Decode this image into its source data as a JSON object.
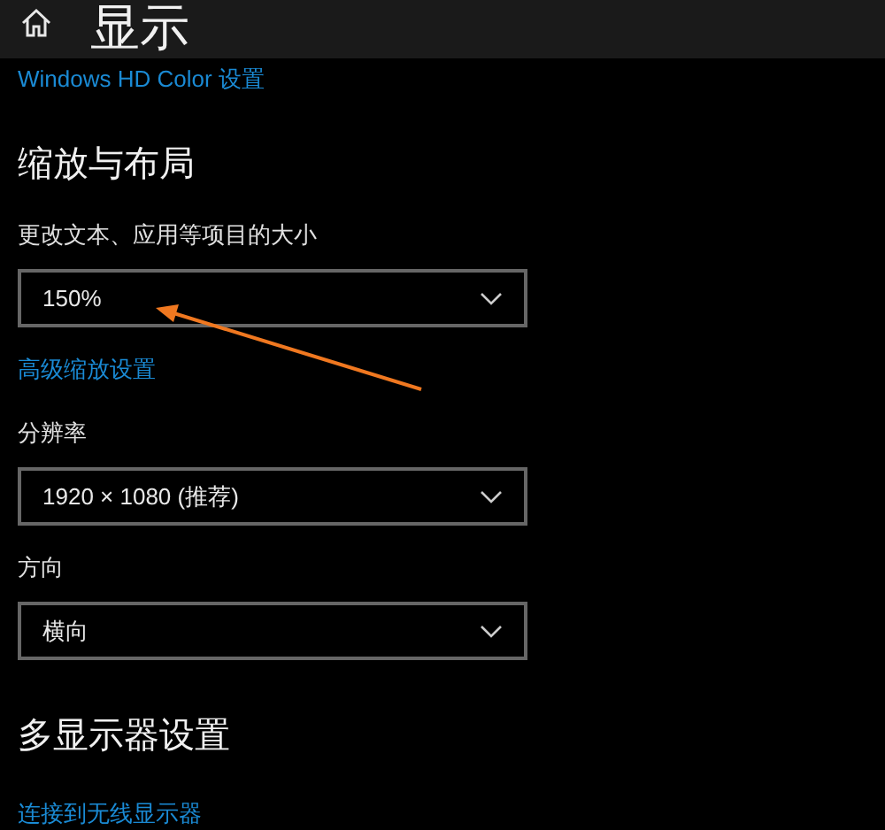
{
  "header": {
    "title": "显示"
  },
  "items": [
    {
      "kind": "link",
      "text": "Windows HD Color 设置"
    },
    {
      "kind": "heading",
      "text": "缩放与布局"
    },
    {
      "kind": "label",
      "text": "更改文本、应用等项目的大小"
    },
    {
      "kind": "dropdown",
      "text": "150%"
    },
    {
      "kind": "link",
      "text": "高级缩放设置"
    },
    {
      "kind": "label",
      "text": "分辨率"
    },
    {
      "kind": "dropdown",
      "text": "1920 × 1080 (推荐)"
    },
    {
      "kind": "label",
      "text": "方向"
    },
    {
      "kind": "dropdown",
      "text": "横向"
    },
    {
      "kind": "heading",
      "text": "多显示器设置"
    },
    {
      "kind": "link",
      "text": "连接到无线显示器"
    }
  ]
}
